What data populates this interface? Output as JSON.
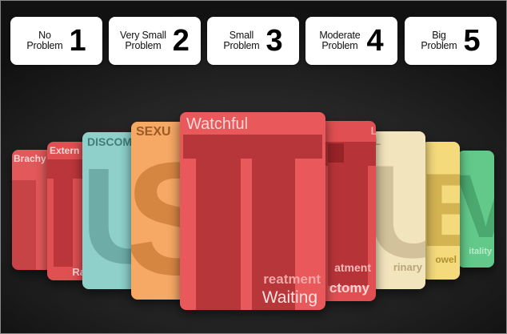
{
  "scale": [
    {
      "label": "No\nProblem",
      "number": "1"
    },
    {
      "label": "Very Small\nProblem",
      "number": "2"
    },
    {
      "label": "Small\nProblem",
      "number": "3"
    },
    {
      "label": "Moderate\nProblem",
      "number": "4"
    },
    {
      "label": "Big\nProblem",
      "number": "5"
    }
  ],
  "cards": {
    "brachy": {
      "title": "Brachy",
      "color": "#e3585a"
    },
    "external": {
      "title": "Extern",
      "foot": "Ra",
      "color": "#e04f52"
    },
    "discomfort": {
      "title": "DISCOM",
      "glyph": "U",
      "color": "#8fd0cb"
    },
    "sexual": {
      "title": "SEXU",
      "glyph": "S",
      "color": "#f6a865"
    },
    "watchful": {
      "title": "Watchful",
      "glyph": "T",
      "subtitle": "reatment",
      "foot": "Waiting",
      "color": "#e9595b"
    },
    "surgery": {
      "title": "L",
      "subtitle": "atment",
      "foot": "ctomy",
      "color": "#e04f52"
    },
    "urinary": {
      "title": "L",
      "glyph": "U",
      "foot": "rinary",
      "color": "#f2e4bd"
    },
    "bowel": {
      "glyph": "B",
      "foot": "owel",
      "color": "#f5da7c"
    },
    "vitality": {
      "glyph": "V",
      "foot": "itality",
      "color": "#63c98b"
    }
  }
}
